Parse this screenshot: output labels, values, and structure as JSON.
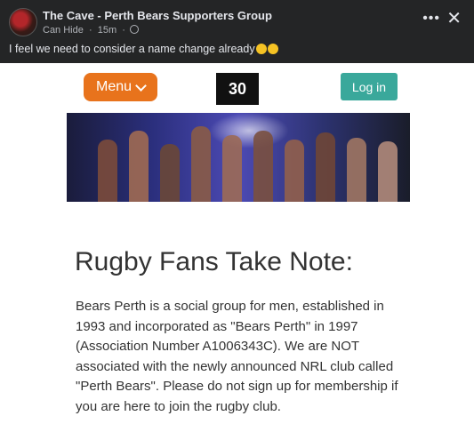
{
  "post": {
    "group_name": "The Cave - Perth Bears Supporters Group",
    "author": "Can Hide",
    "time": "15m",
    "text": "I feel we need to consider a name change already"
  },
  "icons": {
    "avatar": "avatar",
    "more": "more-icon",
    "close": "close-icon",
    "globe": "globe-icon",
    "menu_chevron": "chevron-down-icon",
    "logo": "logo"
  },
  "site": {
    "menu_label": "Menu",
    "logo_text": "30",
    "login_label": "Log in",
    "headline": "Rugby Fans Take Note:",
    "body": "Bears Perth is a social group for men, established in 1993 and incorporated as \"Bears Perth\" in 1997 (Association Number A1006343C). We are NOT associated with the newly announced NRL club called \"Perth Bears\". Please do not sign up for membership if you are here to join the rugby club."
  },
  "colors": {
    "menu_bg": "#e8731c",
    "login_bg": "#3aa89b",
    "fb_dark": "#242526"
  }
}
